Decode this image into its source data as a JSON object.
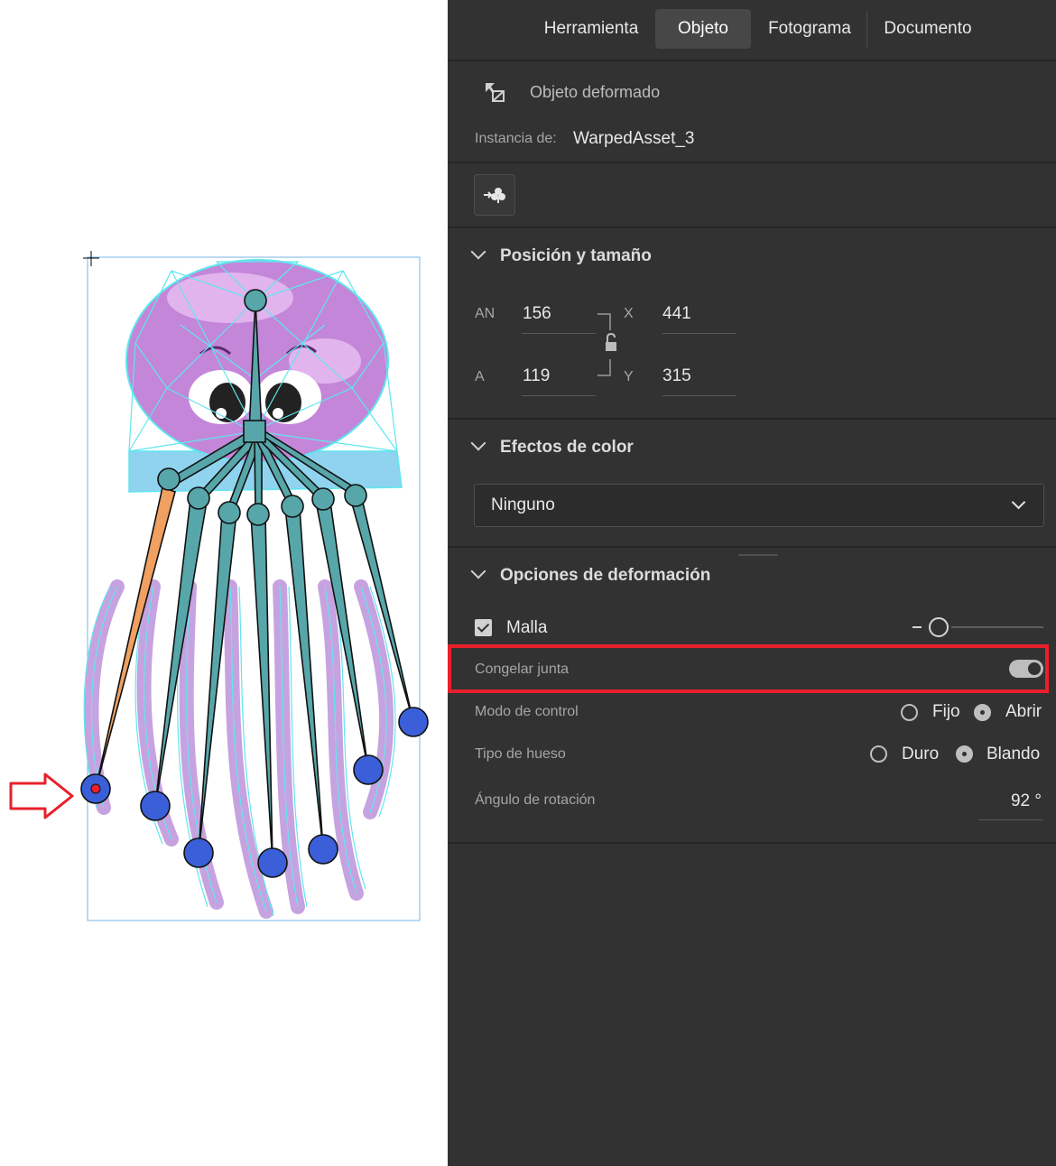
{
  "tabs": [
    {
      "label": "Herramienta",
      "active": false
    },
    {
      "label": "Objeto",
      "active": true
    },
    {
      "label": "Fotograma",
      "active": false
    },
    {
      "label": "Documento",
      "active": false
    }
  ],
  "object": {
    "type_label": "Objeto deformado",
    "type_icon": "warped-object-icon",
    "instance_label": "Instancia de:",
    "instance_value": "WarpedAsset_3",
    "swap_icon": "swap-symbol-icon"
  },
  "position_size": {
    "title": "Posición y tamaño",
    "width_label": "AN",
    "width_value": "156",
    "height_label": "A",
    "height_value": "119",
    "x_label": "X",
    "x_value": "441",
    "y_label": "Y",
    "y_value": "315",
    "lock_icon": "lock-open-icon"
  },
  "color_effects": {
    "title": "Efectos de color",
    "selected": "Ninguno"
  },
  "warp_options": {
    "title": "Opciones de deformación",
    "mesh_label": "Malla",
    "mesh_checked": true,
    "freeze_joint_label": "Congelar junta",
    "freeze_joint_on": true,
    "control_mode_label": "Modo de control",
    "control_mode_options": [
      "Fijo",
      "Abrir"
    ],
    "control_mode_selected": "Abrir",
    "bone_type_label": "Tipo de hueso",
    "bone_type_options": [
      "Duro",
      "Blando"
    ],
    "bone_type_selected": "Blando",
    "rotation_label": "Ángulo de rotación",
    "rotation_value": "92 °"
  },
  "colors": {
    "panel_bg": "#323232",
    "highlight": "#e8202c",
    "mesh": "#5fe6ee",
    "jelly_body": "#c486d8",
    "bone": "#57a6aa",
    "bone_selected": "#f0a060",
    "joint": "#3a5fd8",
    "arrow": "#e8202c"
  }
}
